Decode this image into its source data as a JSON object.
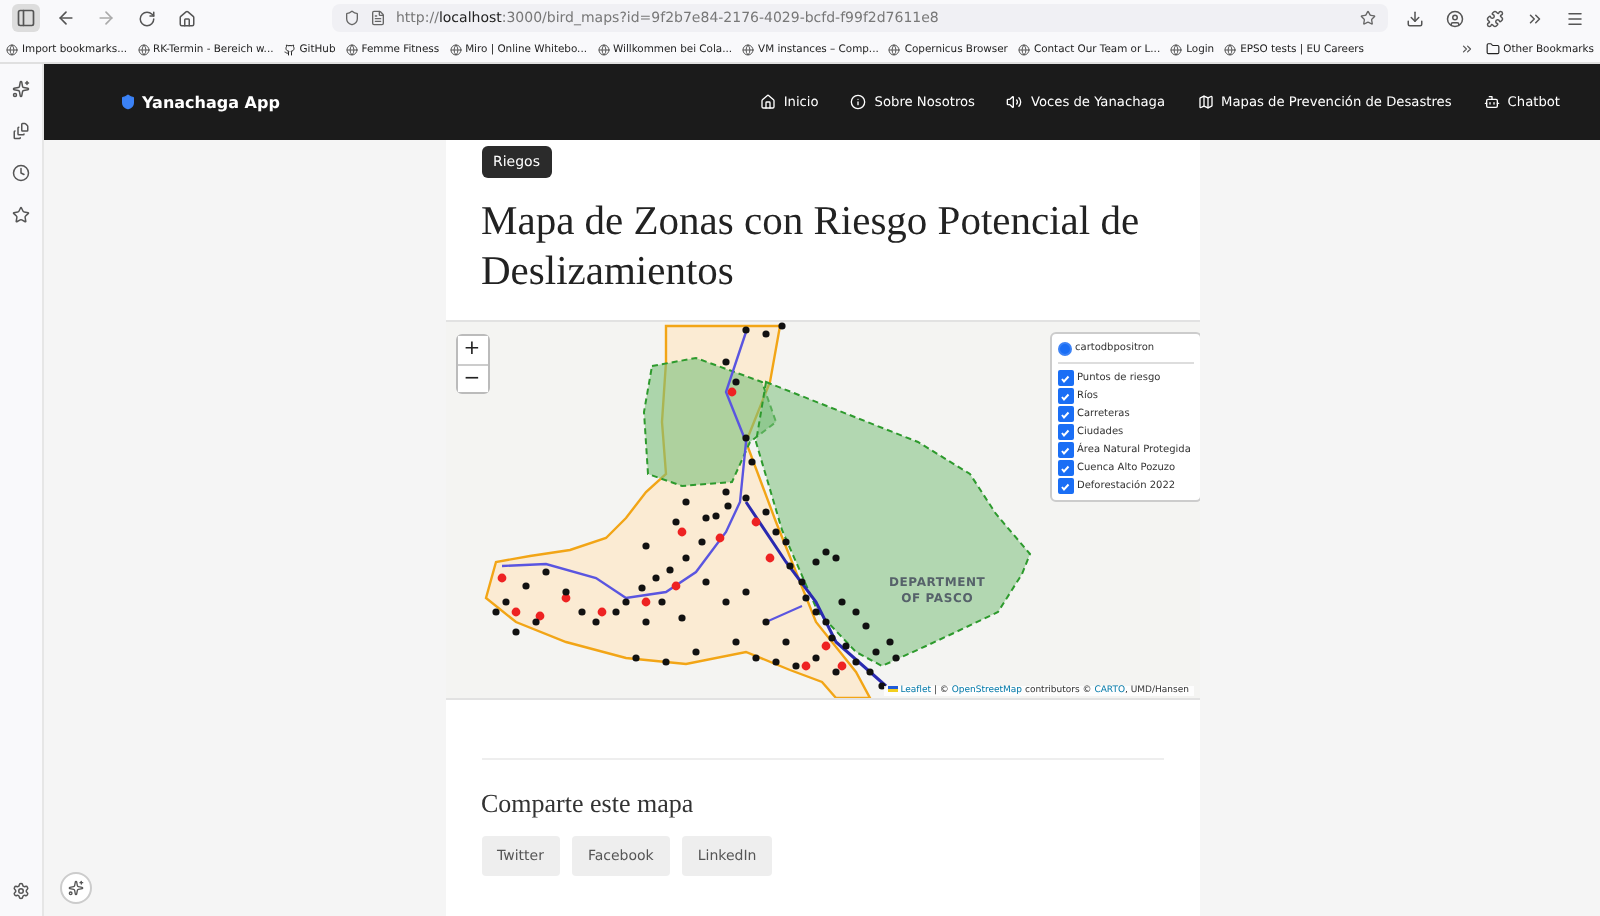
{
  "browser": {
    "url_prefix": "http://",
    "url_host": "localhost",
    "url_rest": ":3000/bird_maps?id=9f2b7e84-2176-4029-bcfd-f99f2d7611e8",
    "bookmarks": [
      {
        "label": "Import bookmarks..."
      },
      {
        "label": "RK-Termin - Bereich w..."
      },
      {
        "label": "GitHub"
      },
      {
        "label": "Femme Fitness"
      },
      {
        "label": "Miro | Online Whitebo..."
      },
      {
        "label": "Willkommen bei Cola..."
      },
      {
        "label": "VM instances – Comp..."
      },
      {
        "label": "Copernicus Browser"
      },
      {
        "label": "Contact Our Team or L..."
      },
      {
        "label": "Login"
      },
      {
        "label": "EPSO tests | EU Careers"
      }
    ],
    "other_bookmarks": "Other Bookmarks"
  },
  "navbar": {
    "brand": "Yanachaga App",
    "items": [
      {
        "label": "Inicio"
      },
      {
        "label": "Sobre Nosotros"
      },
      {
        "label": "Voces de Yanachaga"
      },
      {
        "label": "Mapas de Prevención de Desastres"
      },
      {
        "label": "Chatbot"
      }
    ]
  },
  "page": {
    "tag": "Riegos",
    "title": "Mapa de Zonas con Riesgo Potencial de Deslizamientos",
    "map": {
      "zoom_in": "+",
      "zoom_out": "−",
      "map_label": [
        "DEPARTMENT",
        "OF PASCO"
      ],
      "base_layer": {
        "label": "cartodbpositron",
        "selected": true
      },
      "overlays": [
        {
          "label": "Puntos de riesgo",
          "checked": true
        },
        {
          "label": "Ríos",
          "checked": true
        },
        {
          "label": "Carreteras",
          "checked": true
        },
        {
          "label": "Ciudades",
          "checked": true
        },
        {
          "label": "Área Natural Protegida",
          "checked": true
        },
        {
          "label": "Cuenca Alto Pozuzo",
          "checked": true
        },
        {
          "label": "Deforestación 2022",
          "checked": true
        }
      ],
      "attribution": {
        "leaflet": "Leaflet",
        "sep": " | © ",
        "osm": "OpenStreetMap",
        "mid": " contributors © ",
        "carto": "CARTO",
        "tail": ", UMD/Hansen"
      }
    },
    "share": {
      "heading": "Comparte este mapa",
      "buttons": [
        "Twitter",
        "Facebook",
        "LinkedIn"
      ]
    }
  }
}
